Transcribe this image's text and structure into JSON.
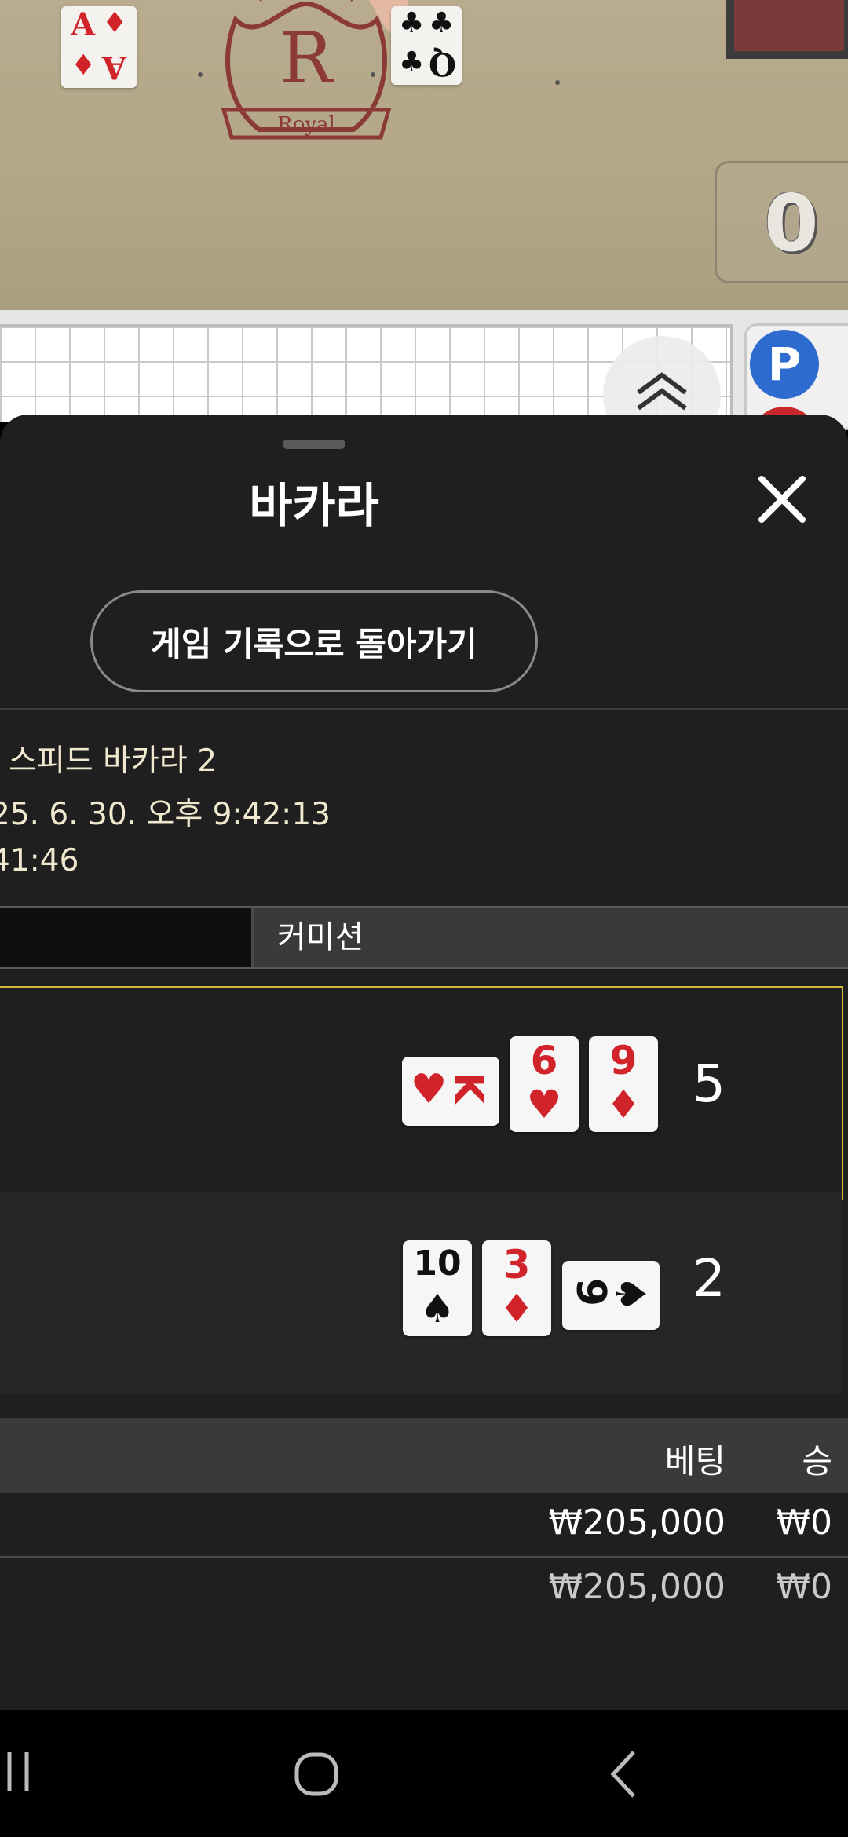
{
  "video": {
    "shoe_logo": "Royal",
    "logo_letter": "R",
    "count_display": "0",
    "cards": [
      {
        "rank": "A",
        "suit": "♦",
        "color": "#d1232a"
      },
      {
        "rank": "Q",
        "suit": "♣",
        "color": "#111111"
      }
    ]
  },
  "roadmap": {
    "player_badge": "P"
  },
  "sheet": {
    "title": "바카라",
    "back_button": "게임 기록으로 돌아가기",
    "info": {
      "table_name": "' 스피드 바카라 2",
      "datetime": "25. 6. 30. 오후 9:42:13",
      "time": "41:46"
    },
    "tabs": {
      "right_label": "커미션"
    },
    "banker": {
      "score": "5",
      "cards": [
        {
          "rank": "K",
          "suit": "♥",
          "color": "#d1232a",
          "rotated": true
        },
        {
          "rank": "6",
          "suit": "♥",
          "color": "#d1232a",
          "rotated": false
        },
        {
          "rank": "9",
          "suit": "♦",
          "color": "#d1232a",
          "rotated": false
        }
      ]
    },
    "player": {
      "score": "2",
      "cards": [
        {
          "rank": "10",
          "suit": "♠",
          "color": "#111111",
          "rotated": false
        },
        {
          "rank": "3",
          "suit": "♦",
          "color": "#d1232a",
          "rotated": false
        },
        {
          "rank": "9",
          "suit": "♠",
          "color": "#111111",
          "rotated": true
        }
      ]
    },
    "bets": {
      "header_bet": "베팅",
      "header_win": "승",
      "rows": [
        {
          "bet": "₩205,000",
          "win": "₩0"
        },
        {
          "bet": "₩205,000",
          "win": "₩0"
        }
      ]
    }
  },
  "colors": {
    "sheet_bg": "#1f1f1f",
    "banker_highlight": "#d4b73a",
    "info_text": "#f1e9cf",
    "red_suit": "#d1232a"
  },
  "icons": [
    "close-icon",
    "chevron-up-icon",
    "recent-apps-icon",
    "home-icon",
    "back-icon"
  ]
}
